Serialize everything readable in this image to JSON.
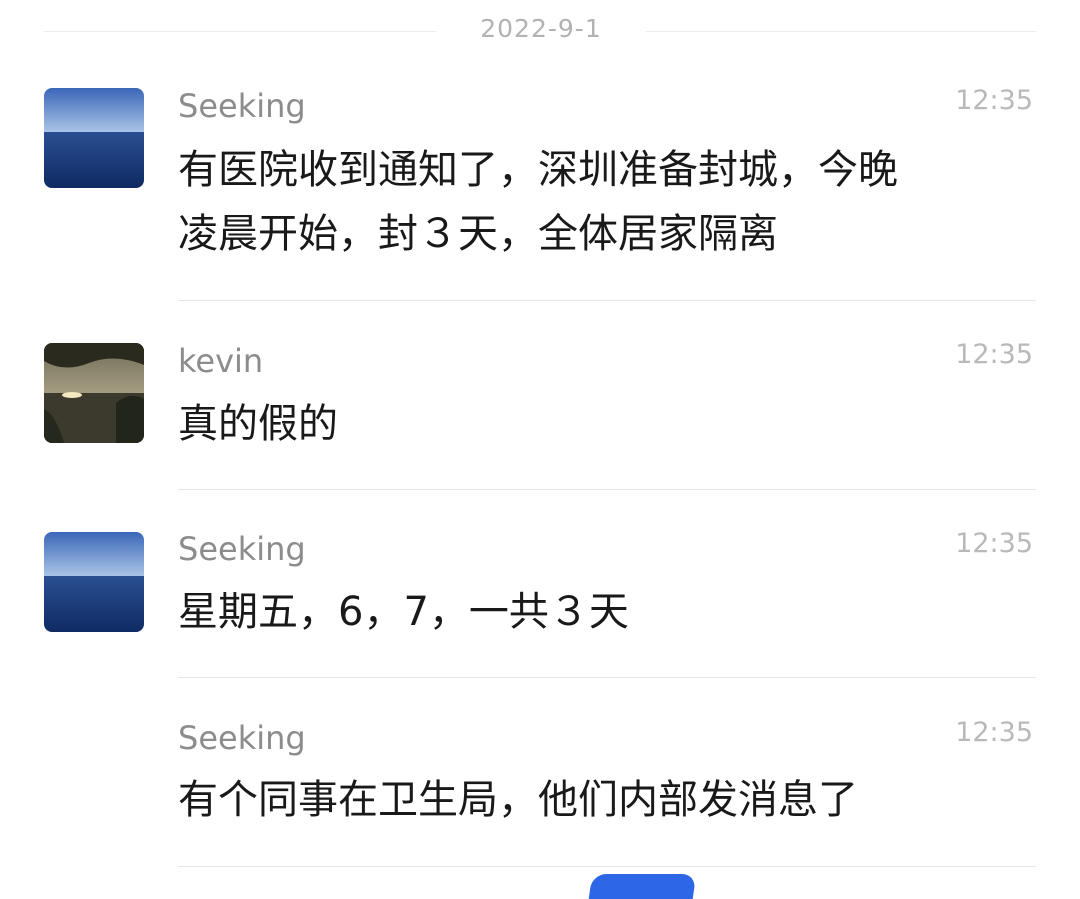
{
  "date_separator": "2022-9-1",
  "messages": [
    {
      "sender": "Seeking",
      "time": "12:35",
      "lines": [
        "有医院收到通知了，深圳准备封城，今晚",
        "凌晨开始，封３天，全体居家隔离"
      ],
      "avatar": "ocean-avatar"
    },
    {
      "sender": "kevin",
      "time": "12:35",
      "lines": [
        "真的假的"
      ],
      "avatar": "sunset-lake-avatar"
    },
    {
      "sender": "Seeking",
      "time": "12:35",
      "lines": [
        "星期五，6，7，一共３天"
      ],
      "avatar": "ocean-avatar"
    },
    {
      "sender": "Seeking",
      "time": "12:35",
      "lines": [
        "有个同事在卫生局，他们内部发消息了"
      ],
      "avatar": null
    }
  ],
  "colors": {
    "accent": "#2e66e8",
    "sender": "#8c8c8c",
    "time": "#b9b9b9",
    "text": "#191919"
  }
}
